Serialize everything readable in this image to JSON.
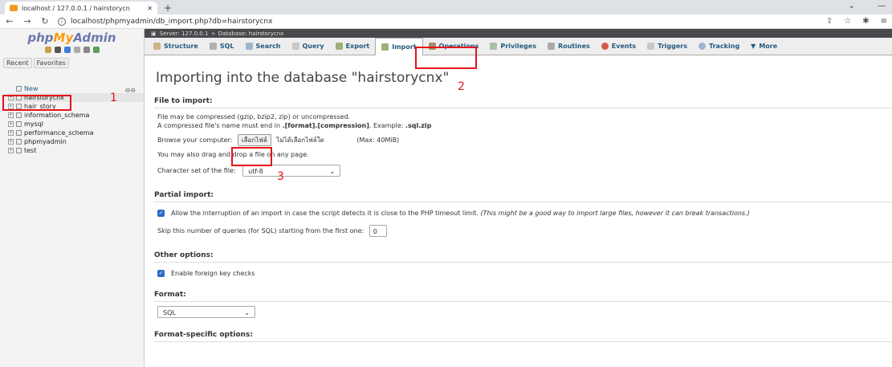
{
  "browser": {
    "tab_title": "localhost / 127.0.0.1 / hairstorycn",
    "url": "localhost/phpmyadmin/db_import.php?db=hairstorycnx"
  },
  "logo": {
    "php": "php",
    "my": "My",
    "admin": "Admin"
  },
  "sidebar": {
    "recent": "Recent",
    "favorites": "Favorites",
    "items": [
      "New",
      "hairstorycnx",
      "hair_story",
      "information_schema",
      "mysql",
      "performance_schema",
      "phpmyadmin",
      "test"
    ]
  },
  "breadcrumb": {
    "server": "Server: 127.0.0.1",
    "database": "Database: hairstorycnx"
  },
  "tabs": [
    "Structure",
    "SQL",
    "Search",
    "Query",
    "Export",
    "Import",
    "Operations",
    "Privileges",
    "Routines",
    "Events",
    "Triggers",
    "Tracking",
    "More"
  ],
  "page_title": "Importing into the database \"hairstorycnx\"",
  "file_section": {
    "title": "File to import:",
    "line1": "File may be compressed (gzip, bzip2, zip) or uncompressed.",
    "line2_prefix": "A compressed file's name must end in ",
    "line2_bold": ".[format].[compression]",
    "line2_mid": ". Example: ",
    "line2_example": ".sql.zip",
    "browse_label": "Browse your computer:",
    "choose_button": "เลือกไฟล์",
    "no_file": "ไม่ได้เลือกไฟล์ใด",
    "max": "(Max: 40MiB)",
    "drag_hint": "You may also drag and drop a file on any page.",
    "charset_label": "Character set of the file:",
    "charset_value": "utf-8"
  },
  "partial_section": {
    "title": "Partial import:",
    "allow_text": "Allow the interruption of an import in case the script detects it is close to the PHP timeout limit.",
    "allow_note": "(This might be a good way to import large files, however it can break transactions.)",
    "skip_label": "Skip this number of queries (for SQL) starting from the first one:",
    "skip_value": "0"
  },
  "other_section": {
    "title": "Other options:",
    "fk_label": "Enable foreign key checks"
  },
  "format_section": {
    "title": "Format:",
    "value": "SQL"
  },
  "format_specific": {
    "title": "Format-specific options:"
  },
  "annotations": {
    "n1": "1",
    "n2": "2",
    "n3": "3"
  },
  "colors": {
    "annotation": "#e8121b",
    "link": "#235a81"
  }
}
